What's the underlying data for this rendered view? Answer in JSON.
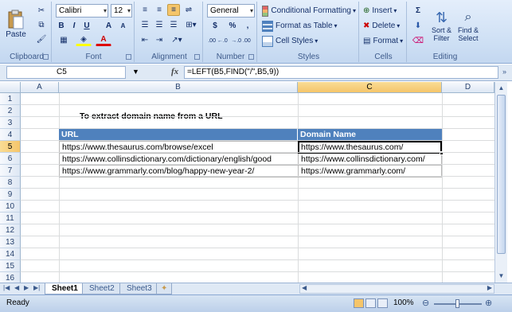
{
  "ribbon": {
    "clipboard": {
      "label": "Clipboard",
      "paste": "Paste"
    },
    "font": {
      "label": "Font",
      "name": "Calibri",
      "size": "12",
      "bold": "B",
      "italic": "I",
      "underline": "U",
      "grow": "A",
      "shrink": "A"
    },
    "alignment": {
      "label": "Alignment"
    },
    "number": {
      "label": "Number",
      "format": "General",
      "currency": "$",
      "percent": "%",
      "comma": ",",
      "inc": ".00 ←.0",
      "dec": "→.0 .00"
    },
    "styles": {
      "label": "Styles",
      "conditional": "Conditional Formatting",
      "table": "Format as Table",
      "cell": "Cell Styles"
    },
    "cells": {
      "label": "Cells",
      "insert": "Insert",
      "delete": "Delete",
      "format": "Format"
    },
    "editing": {
      "label": "Editing",
      "sigma": "Σ",
      "sort": "Sort &",
      "filter": "Filter",
      "find": "Find &",
      "select": "Select"
    }
  },
  "formula_bar": {
    "name_box": "C5",
    "fx": "fx",
    "formula": "=LEFT(B5,FIND(\"/\",B5,9))"
  },
  "columns": [
    "A",
    "B",
    "C",
    "D"
  ],
  "rows": [
    "1",
    "2",
    "3",
    "4",
    "5",
    "6",
    "7",
    "8",
    "9",
    "10",
    "11",
    "12",
    "13",
    "14",
    "15",
    "16"
  ],
  "sheet": {
    "title": "To extract domain name from a URL",
    "headers": {
      "url": "URL",
      "domain": "Domain Name"
    },
    "data": [
      {
        "url": "https://www.thesaurus.com/browse/excel",
        "domain": "https://www.thesaurus.com/"
      },
      {
        "url": "https://www.collinsdictionary.com/dictionary/english/good",
        "domain": "https://www.collinsdictionary.com/"
      },
      {
        "url": "https://www.grammarly.com/blog/happy-new-year-2/",
        "domain": "https://www.grammarly.com/"
      }
    ]
  },
  "tabs": [
    "Sheet1",
    "Sheet2",
    "Sheet3"
  ],
  "status": {
    "ready": "Ready",
    "zoom": "100%"
  },
  "colors": {
    "header_fill": "#4f81bd",
    "selection": "#f5c56a"
  }
}
